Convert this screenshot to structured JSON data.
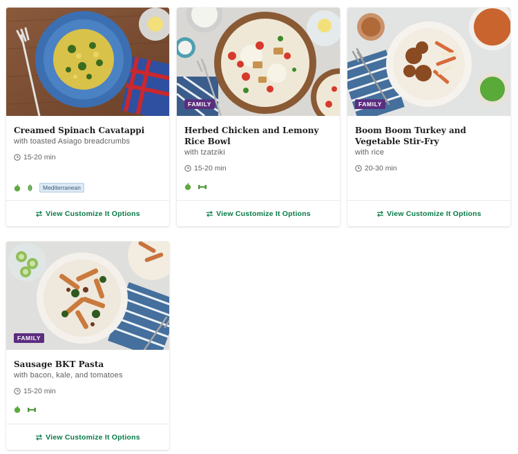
{
  "recipes": [
    {
      "title": "Creamed Spinach Cavatappi",
      "subtitle": "with toasted Asiago breadcrumbs",
      "time": "15-20 min",
      "badge": "",
      "icons": [
        "apple-icon",
        "leaf-icon"
      ],
      "cuisine": "Mediterranean",
      "action": "View Customize It Options"
    },
    {
      "title": "Herbed Chicken and Lemony Rice Bowl",
      "subtitle": "with tzatziki",
      "time": "15-20 min",
      "badge": "FAMILY",
      "icons": [
        "apple-icon",
        "dumbbell-icon"
      ],
      "action": "View Customize It Options"
    },
    {
      "title": "Boom Boom Turkey and Vegetable Stir-Fry",
      "subtitle": "with rice",
      "time": "20-30 min",
      "badge": "FAMILY",
      "icons": [],
      "action": "View Customize It Options"
    },
    {
      "title": "Sausage BKT Pasta",
      "subtitle": "with bacon, kale, and tomatoes",
      "time": "15-20 min",
      "badge": "FAMILY",
      "icons": [
        "apple-icon",
        "dumbbell-icon"
      ],
      "action": "View Customize It Options"
    }
  ],
  "colors": {
    "accent_green": "#067a46",
    "family_purple": "#5b2d7e",
    "cuisine_tag_bg": "#dce9f5"
  }
}
